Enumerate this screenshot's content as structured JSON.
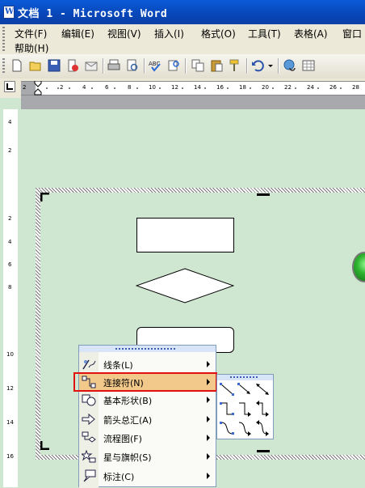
{
  "window": {
    "title": "文档 1 - Microsoft Word",
    "title_icon": "W"
  },
  "menubar": {
    "items": [
      {
        "label": "文件(F)"
      },
      {
        "label": "编辑(E)"
      },
      {
        "label": "视图(V)"
      },
      {
        "label": "插入(I)"
      },
      {
        "label": "格式(O)"
      },
      {
        "label": "工具(T)"
      },
      {
        "label": "表格(A)"
      },
      {
        "label": "窗口"
      },
      {
        "label": "帮助(H)"
      }
    ]
  },
  "toolbar": {
    "icons": [
      "new-document-icon",
      "open-folder-icon",
      "save-icon",
      "permission-icon",
      "email-icon",
      "print-icon",
      "print-preview-icon",
      "spelling-icon",
      "research-icon",
      "cut-icon",
      "copy-icon",
      "paste-icon",
      "format-painter-icon",
      "undo-icon",
      "undo-dropdown-icon",
      "hyperlink-icon",
      "tables-borders-icon"
    ]
  },
  "ruler": {
    "tab_button": "L",
    "h_labels": [
      "2",
      "2",
      "4",
      "6",
      "8",
      "10",
      "12",
      "14",
      "16",
      "18",
      "20",
      "22",
      "24",
      "26",
      "28"
    ],
    "v_labels_top": [
      "4",
      "2"
    ],
    "v_labels": [
      "2",
      "4",
      "6",
      "8",
      "10",
      "12",
      "14",
      "16"
    ]
  },
  "context_menu": {
    "items": [
      {
        "label": "线条(L)",
        "icon": "lines-icon",
        "has_submenu": true
      },
      {
        "label": "连接符(N)",
        "icon": "connector-icon",
        "has_submenu": true,
        "highlighted": true
      },
      {
        "label": "基本形状(B)",
        "icon": "basic-shapes-icon",
        "has_submenu": true
      },
      {
        "label": "箭头总汇(A)",
        "icon": "block-arrows-icon",
        "has_submenu": true
      },
      {
        "label": "流程图(F)",
        "icon": "flowchart-icon",
        "has_submenu": true
      },
      {
        "label": "星与旗帜(S)",
        "icon": "stars-banners-icon",
        "has_submenu": true
      },
      {
        "label": "标注(C)",
        "icon": "callouts-icon",
        "has_submenu": true
      }
    ]
  },
  "connectors_submenu": {
    "items": [
      "straight-connector-icon",
      "straight-arrow-connector-icon",
      "straight-double-arrow-connector-icon",
      "elbow-connector-icon",
      "elbow-arrow-connector-icon",
      "elbow-double-arrow-connector-icon",
      "curved-connector-icon",
      "curved-arrow-connector-icon",
      "curved-double-arrow-connector-icon"
    ]
  },
  "colors": {
    "title_bar": "#0846b8",
    "menu_bg": "#ece9d8",
    "workspace_bg": "#cfe6d0",
    "highlight_border": "#e01010"
  }
}
